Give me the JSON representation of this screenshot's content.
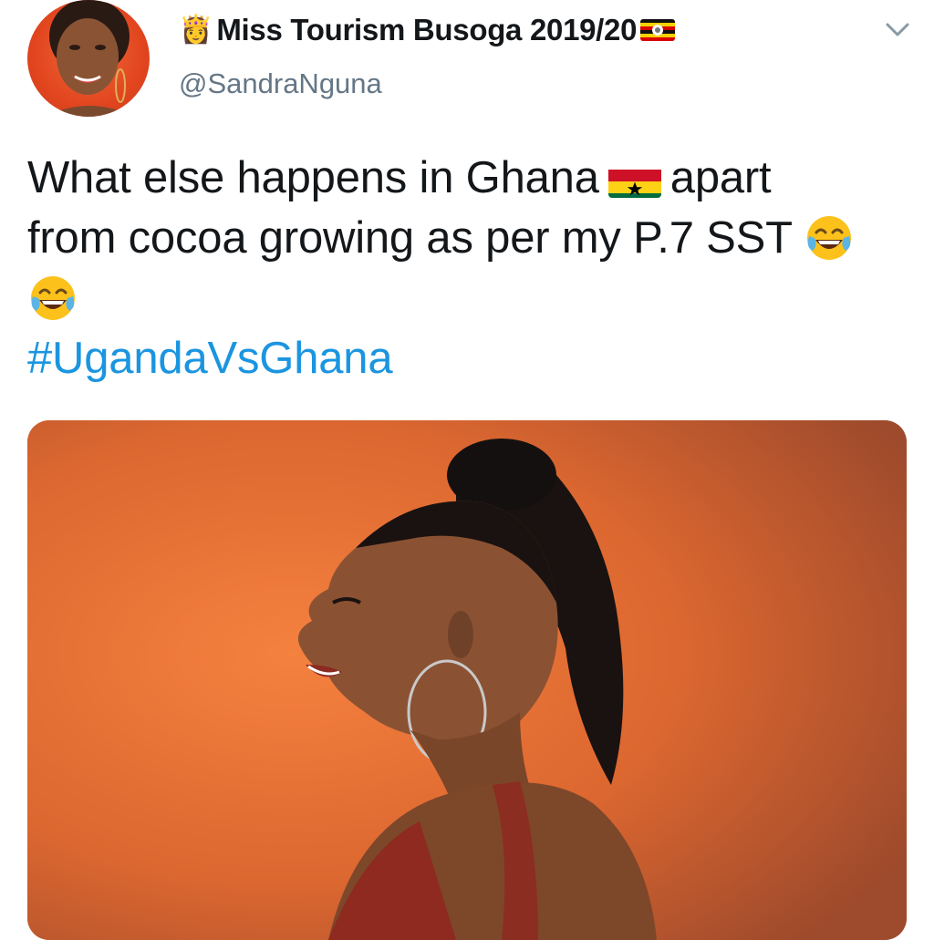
{
  "author": {
    "display_name": "Miss Tourism Busoga 2019/20",
    "name_prefix_icon": "princess-emoji",
    "name_suffix_icon": "uganda-flag-emoji",
    "handle": "@SandraNguna"
  },
  "tweet": {
    "text_line_1_a": "What else happens in Ghana",
    "text_line_1_b": "apart",
    "text_line_2": "from cocoa growing as per my P.7 SST",
    "hashtag": "#UgandaVsGhana",
    "inline_icons": [
      "ghana-flag-emoji",
      "tears-of-joy-emoji",
      "tears-of-joy-emoji"
    ]
  },
  "colors": {
    "hashtag": "#1b95e0",
    "handle": "#657786",
    "text": "#14171a",
    "media_background": "#e0692f"
  }
}
